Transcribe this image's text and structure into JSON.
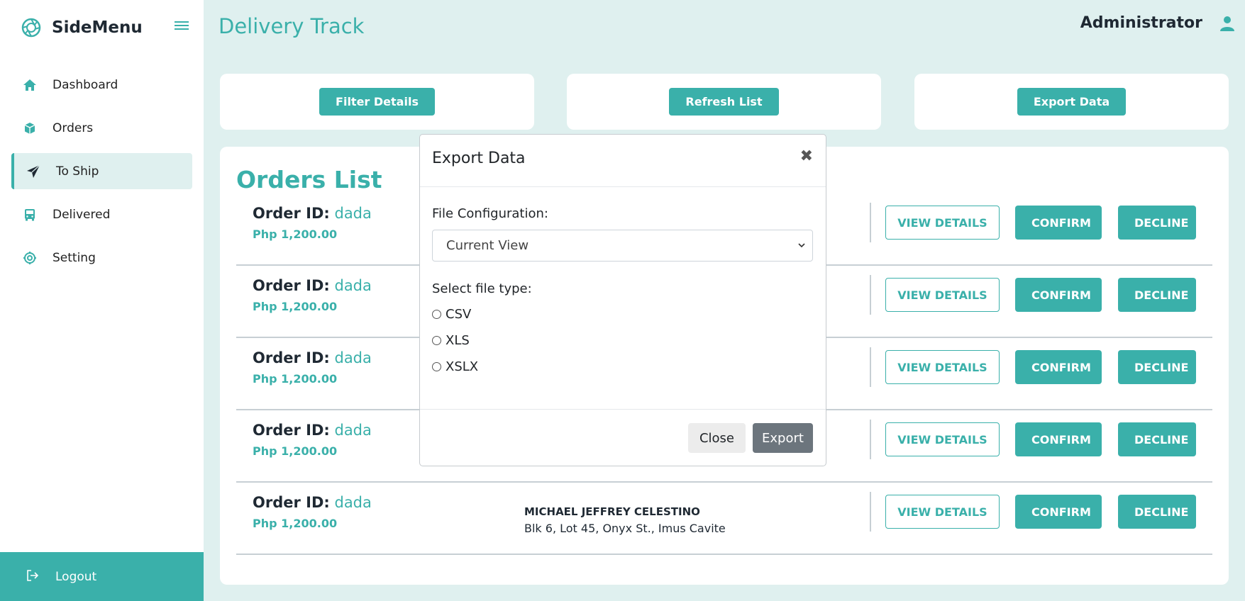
{
  "sidebar": {
    "brand": "SideMenu",
    "items": [
      {
        "label": "Dashboard",
        "icon": "home-icon"
      },
      {
        "label": "Orders",
        "icon": "box-icon"
      },
      {
        "label": "To Ship",
        "icon": "paper-plane-icon",
        "active": true
      },
      {
        "label": "Delivered",
        "icon": "bus-icon"
      },
      {
        "label": "Setting",
        "icon": "gear-icon"
      }
    ],
    "logout_label": "Logout"
  },
  "header": {
    "title": "Delivery Track",
    "user_name": "Administrator"
  },
  "actions": {
    "filter_label": "Filter Details",
    "refresh_label": "Refresh List",
    "export_label": "Export Data"
  },
  "orders_panel": {
    "title": "Orders List",
    "id_key": "Order ID:",
    "view_label": "VIEW DETAILS",
    "confirm_label": "CONFIRM",
    "decline_label": "DECLINE",
    "rows": [
      {
        "id": "dada",
        "price": "Php 1,200.00",
        "customer_name": "",
        "address": ""
      },
      {
        "id": "dada",
        "price": "Php 1,200.00",
        "customer_name": "",
        "address": ""
      },
      {
        "id": "dada",
        "price": "Php 1,200.00",
        "customer_name": "",
        "address": ""
      },
      {
        "id": "dada",
        "price": "Php 1,200.00",
        "customer_name": "",
        "address": ""
      },
      {
        "id": "dada",
        "price": "Php 1,200.00",
        "customer_name": "MICHAEL JEFFREY CELESTINO",
        "address": "Blk 6, Lot 45, Onyx St., Imus Cavite"
      }
    ]
  },
  "modal": {
    "title": "Export Data",
    "close_symbol": "✖",
    "file_config_label": "File Configuration:",
    "file_config_value": "Current View",
    "file_type_label": "Select file type:",
    "file_types": [
      "CSV",
      "XLS",
      "XSLX"
    ],
    "close_button": "Close",
    "export_button": "Export"
  },
  "colors": {
    "accent": "#3ab0aa",
    "background": "#dff0ef",
    "secondary": "#6c757d"
  }
}
